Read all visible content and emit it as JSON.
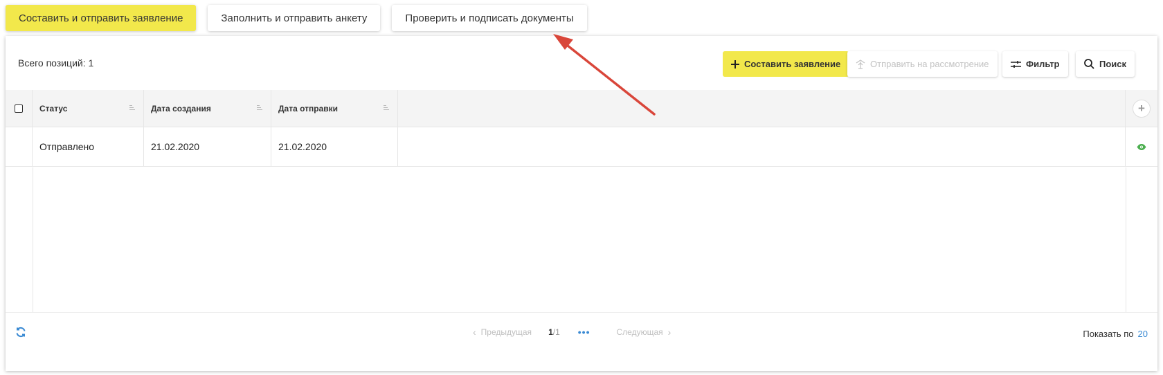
{
  "top_tabs": [
    {
      "label": "Составить и отправить заявление",
      "active": true
    },
    {
      "label": "Заполнить и отправить анкету",
      "active": false
    },
    {
      "label": "Проверить и подписать документы",
      "active": false
    }
  ],
  "toolbar": {
    "total_label": "Всего позиций: 1",
    "compose_label": "Составить заявление",
    "send_label": "Отправить на рассмотрение",
    "filter_label": "Фильтр",
    "search_label": "Поиск"
  },
  "table": {
    "headers": {
      "status": "Статус",
      "created": "Дата создания",
      "sent": "Дата отправки"
    },
    "rows": [
      {
        "status": "Отправлено",
        "created": "21.02.2020",
        "sent": "21.02.2020"
      }
    ]
  },
  "footer": {
    "prev_label": "Предыдущая",
    "current_page": "1",
    "total_pages": "/1",
    "next_label": "Следующая",
    "show_by_label": "Показать по",
    "show_by_value": "20"
  },
  "colors": {
    "accent_yellow": "#f2e84b",
    "link_blue": "#3a8ad3",
    "eye_green": "#4caf50",
    "arrow_red": "#d9463a"
  },
  "icons": [
    "plus-icon",
    "upload-icon",
    "filter-icon",
    "search-icon",
    "add-column-icon",
    "eye-icon",
    "refresh-icon",
    "annotation-arrow"
  ]
}
